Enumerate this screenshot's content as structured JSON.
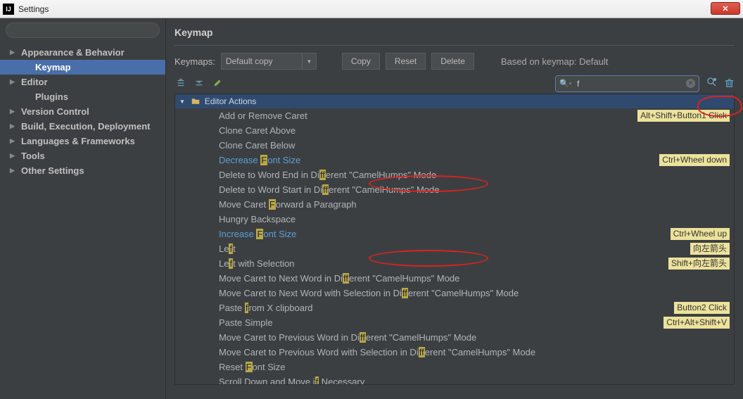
{
  "window": {
    "title": "Settings"
  },
  "sidebar": {
    "search_placeholder": "",
    "items": [
      {
        "label": "Appearance & Behavior",
        "has_arrow": true
      },
      {
        "label": "Keymap",
        "has_arrow": false,
        "child": true,
        "selected": true
      },
      {
        "label": "Editor",
        "has_arrow": true
      },
      {
        "label": "Plugins",
        "has_arrow": false,
        "child": true
      },
      {
        "label": "Version Control",
        "has_arrow": true
      },
      {
        "label": "Build, Execution, Deployment",
        "has_arrow": true
      },
      {
        "label": "Languages & Frameworks",
        "has_arrow": true
      },
      {
        "label": "Tools",
        "has_arrow": true
      },
      {
        "label": "Other Settings",
        "has_arrow": true
      }
    ]
  },
  "header": {
    "title": "Keymap"
  },
  "keymap_bar": {
    "label": "Keymaps:",
    "selected": "Default copy",
    "copy": "Copy",
    "reset": "Reset",
    "delete": "Delete",
    "based_on": "Based on keymap: Default"
  },
  "action_search": {
    "value": "f"
  },
  "action_tree": {
    "group": "Editor Actions",
    "rows": [
      {
        "pre": "Add or Remove Caret",
        "hl": "",
        "post": "",
        "shortcut": "Alt+Shift+Button1 Click"
      },
      {
        "pre": "Clone Caret Above",
        "hl": "",
        "post": ""
      },
      {
        "pre": "Clone Caret Below",
        "hl": "",
        "post": ""
      },
      {
        "pre": "Decrease ",
        "hl": "F",
        "post": "ont Size",
        "link": true,
        "shortcut": "Ctrl+Wheel down"
      },
      {
        "pre": "Delete to Word End in Di",
        "hl": "ff",
        "post": "erent \"CamelHumps\" Mode"
      },
      {
        "pre": "Delete to Word Start in Di",
        "hl": "ff",
        "post": "erent \"CamelHumps\" Mode"
      },
      {
        "pre": "Move Caret ",
        "hl": "F",
        "post": "orward a Paragraph"
      },
      {
        "pre": "Hungry Backspace",
        "hl": "",
        "post": ""
      },
      {
        "pre": "Increase ",
        "hl": "F",
        "post": "ont Size",
        "link": true,
        "shortcut": "Ctrl+Wheel up"
      },
      {
        "pre": "Le",
        "hl": "f",
        "post": "t",
        "shortcut": "向左箭头"
      },
      {
        "pre": "Le",
        "hl": "f",
        "post": "t with Selection",
        "shortcut": "Shift+向左箭头"
      },
      {
        "pre": "Move Caret to Next Word in Di",
        "hl": "ff",
        "post": "erent \"CamelHumps\" Mode"
      },
      {
        "pre": "Move Caret to Next Word with Selection in Di",
        "hl": "ff",
        "post": "erent \"CamelHumps\" Mode"
      },
      {
        "pre": "Paste ",
        "hl": "f",
        "post": "rom X clipboard",
        "shortcut": "Button2 Click"
      },
      {
        "pre": "Paste Simple",
        "hl": "",
        "post": "",
        "shortcut": "Ctrl+Alt+Shift+V"
      },
      {
        "pre": "Move Caret to Previous Word in Di",
        "hl": "ff",
        "post": "erent \"CamelHumps\" Mode"
      },
      {
        "pre": "Move Caret to Previous Word with Selection in Di",
        "hl": "ff",
        "post": "erent \"CamelHumps\" Mode"
      },
      {
        "pre": "Reset ",
        "hl": "F",
        "post": "ont Size"
      },
      {
        "pre": "Scroll Down and Move i",
        "hl": "f",
        "post": " Necessary"
      }
    ]
  }
}
